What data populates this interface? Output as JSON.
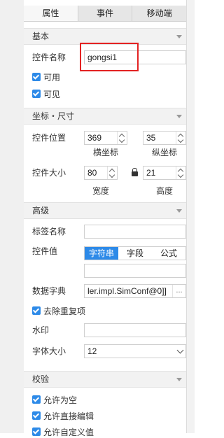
{
  "tabs": [
    "属性",
    "事件",
    "移动端"
  ],
  "sections": {
    "basic": "基本",
    "coords": "坐标・尺寸",
    "advanced": "高级",
    "validation": "校验"
  },
  "basic": {
    "name_label": "控件名称",
    "name_value": "gongsi1",
    "enabled_label": "可用",
    "visible_label": "可见"
  },
  "coords": {
    "position_label": "控件位置",
    "x_value": "369",
    "y_value": "35",
    "x_caption": "横坐标",
    "y_caption": "纵坐标",
    "size_label": "控件大小",
    "width_value": "80",
    "height_value": "21",
    "width_caption": "宽度",
    "height_caption": "高度"
  },
  "advanced": {
    "tag_name_label": "标签名称",
    "tag_name_value": "",
    "value_label": "控件值",
    "value_modes": [
      "字符串",
      "字段",
      "公式"
    ],
    "value_mode_selected": "字符串",
    "value_text": "",
    "dict_label": "数据字典",
    "dict_value": "ler.impl.SimConf@0]]",
    "dict_button": "...",
    "dedupe_label": "去除重复项",
    "watermark_label": "水印",
    "watermark_value": "",
    "fontsize_label": "字体大小",
    "fontsize_value": "12"
  },
  "validation": {
    "allow_empty": "允许为空",
    "allow_direct_edit": "允许直接编辑",
    "allow_custom_value": "允许自定义值"
  },
  "colors": {
    "accent": "#2d8ae8",
    "highlight": "#e32222"
  }
}
